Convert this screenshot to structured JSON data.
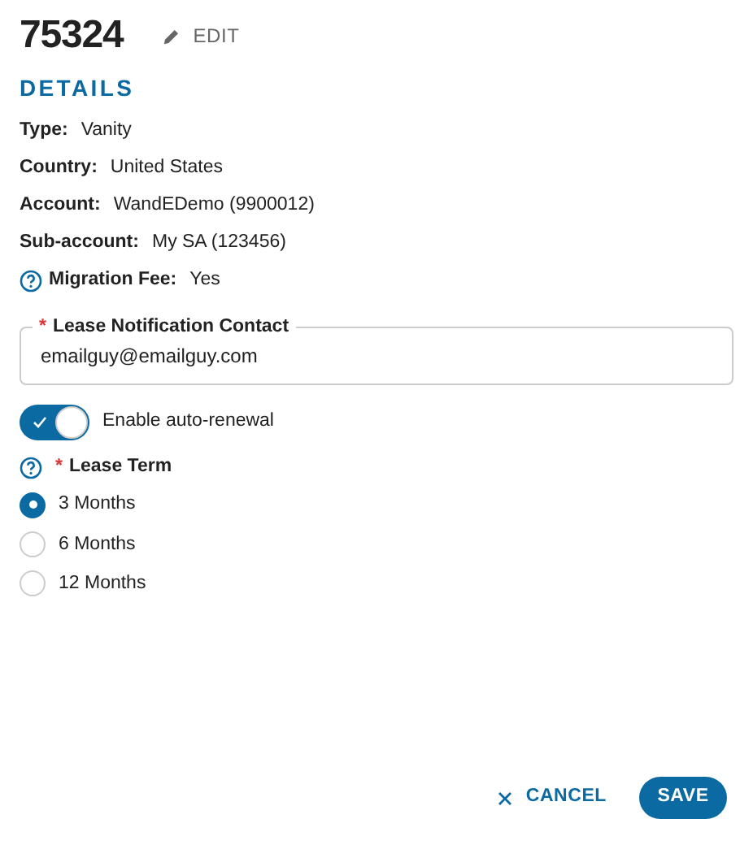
{
  "header": {
    "title": "75324",
    "edit_label": "EDIT"
  },
  "details": {
    "heading": "DETAILS",
    "rows": [
      {
        "label": "Type:",
        "value": "Vanity",
        "help": false
      },
      {
        "label": "Country:",
        "value": "United States",
        "help": false
      },
      {
        "label": "Account:",
        "value": "WandEDemo (9900012)",
        "help": false
      },
      {
        "label": "Sub-account:",
        "value": "My SA (123456)",
        "help": false
      },
      {
        "label": "Migration Fee:",
        "value": "Yes",
        "help": true
      }
    ]
  },
  "contact_field": {
    "label": "Lease Notification Contact",
    "required_mark": "*",
    "value": "emailguy@emailguy.com"
  },
  "auto_renewal": {
    "label": "Enable auto-renewal",
    "on": true
  },
  "lease_term": {
    "label": "Lease Term",
    "required_mark": "*",
    "help": true,
    "options": [
      {
        "label": "3 Months",
        "selected": true
      },
      {
        "label": "6 Months",
        "selected": false
      },
      {
        "label": "12 Months",
        "selected": false
      }
    ]
  },
  "actions": {
    "cancel": "CANCEL",
    "save": "SAVE"
  }
}
